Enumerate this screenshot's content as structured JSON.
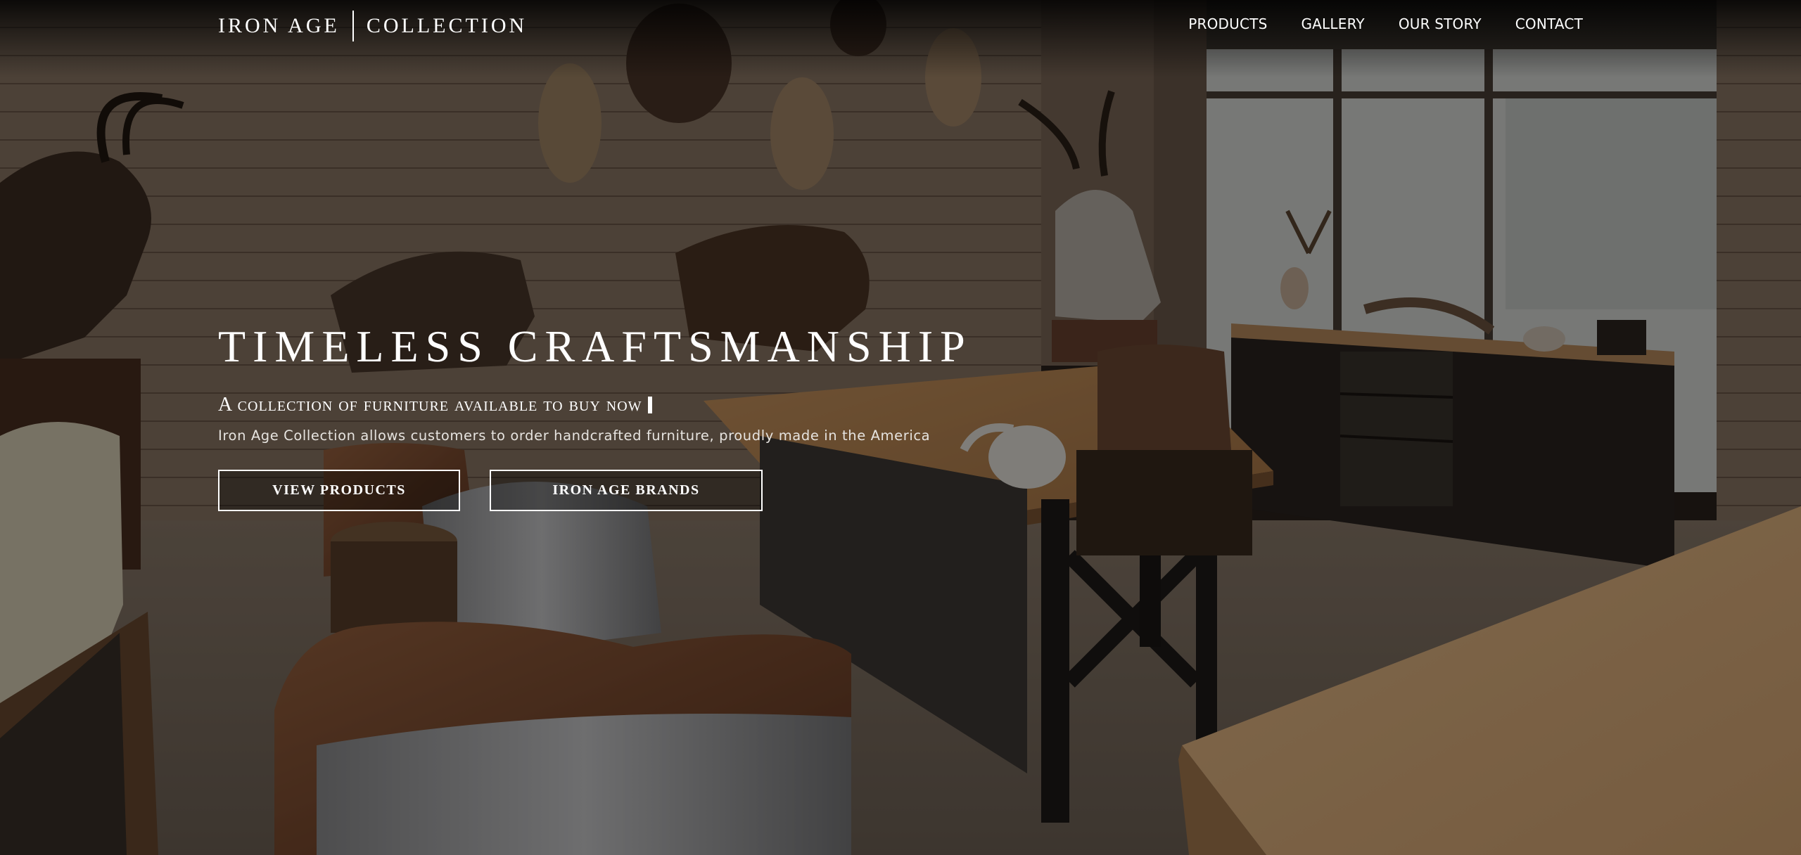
{
  "brand": {
    "name_left": "IRON AGE",
    "name_right": "COLLECTION"
  },
  "nav": {
    "items": [
      {
        "label": "PRODUCTS"
      },
      {
        "label": "GALLERY"
      },
      {
        "label": "OUR STORY"
      },
      {
        "label": "CONTACT"
      }
    ]
  },
  "hero": {
    "title": "TIMELESS CRAFTSMANSHIP",
    "subtitle": "A collection of furniture available to buy now",
    "description": "Iron Age Collection allows customers to order handcrafted furniture, proudly made in the America",
    "buttons": {
      "view_products": "VIEW PRODUCTS",
      "iron_age_brands": "IRON AGE BRANDS"
    }
  },
  "colors": {
    "text": "#ffffff",
    "overlay": "#000000",
    "wall_wood": "#8a7561",
    "desk_wood": "#b8875a",
    "leather": "#7a4a2c"
  }
}
